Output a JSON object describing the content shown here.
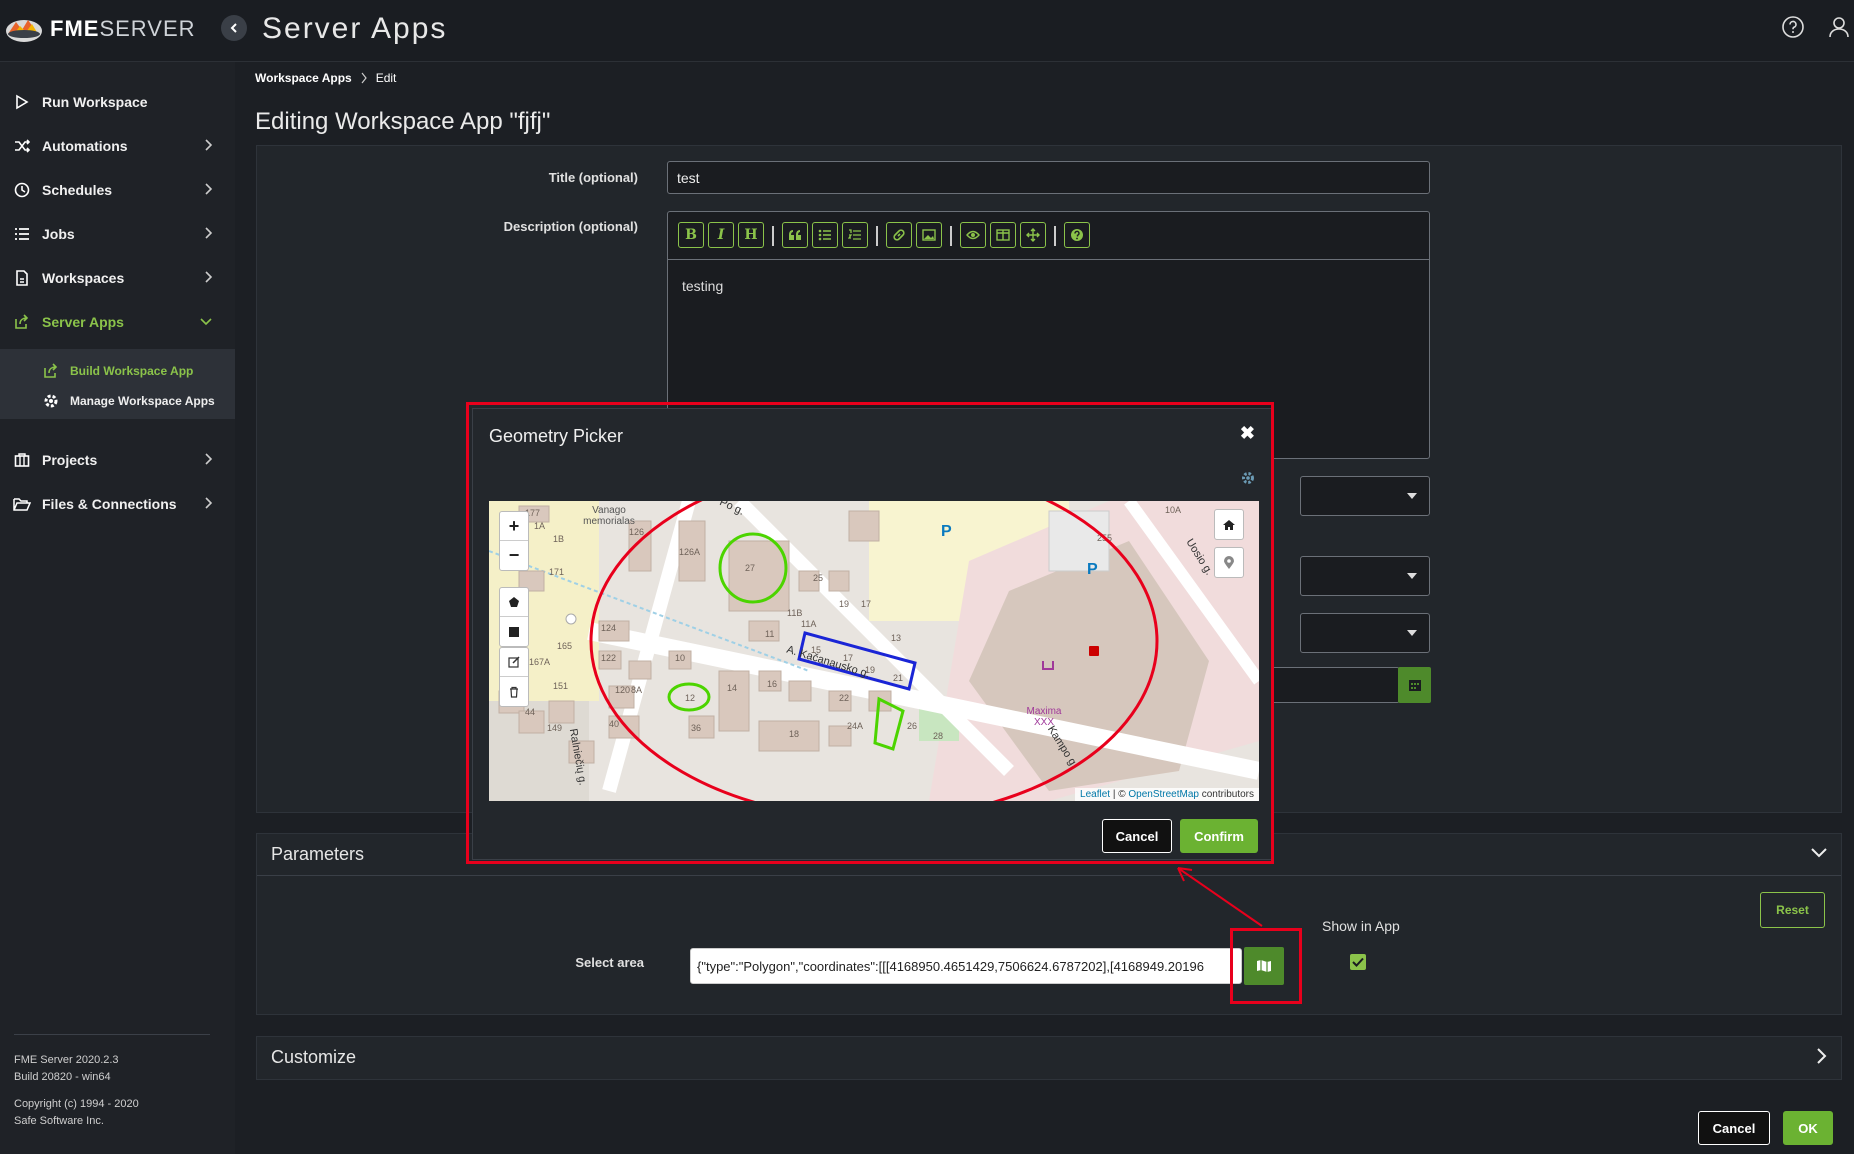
{
  "header": {
    "brand_bold": "FME",
    "brand_rest": "SERVER",
    "page_title": "Server Apps"
  },
  "sidebar": {
    "items": [
      {
        "label": "Run Workspace"
      },
      {
        "label": "Automations"
      },
      {
        "label": "Schedules"
      },
      {
        "label": "Jobs"
      },
      {
        "label": "Workspaces"
      },
      {
        "label": "Server Apps"
      },
      {
        "label": "Projects"
      },
      {
        "label": "Files & Connections"
      }
    ],
    "sub_items": [
      {
        "label": "Build Workspace App"
      },
      {
        "label": "Manage Workspace Apps"
      }
    ],
    "footer": {
      "version": "FME Server 2020.2.3",
      "build": "Build 20820 - win64",
      "copyright": "Copyright (c) 1994 - 2020",
      "company": "Safe Software Inc."
    }
  },
  "breadcrumb": {
    "parent": "Workspace Apps",
    "current": "Edit"
  },
  "page": {
    "title": "Editing Workspace App \"fjfj\""
  },
  "form": {
    "title_label": "Title (optional)",
    "title_value": "test",
    "description_label": "Description (optional)",
    "description_value": "testing"
  },
  "parameters": {
    "header": "Parameters",
    "reset_label": "Reset",
    "show_in_app_label": "Show in App",
    "select_area_label": "Select area",
    "select_area_value": "{\"type\":\"Polygon\",\"coordinates\":[[[4168950.4651429,7506624.6787202],[4168949.20196"
  },
  "customize": {
    "header": "Customize"
  },
  "footer_buttons": {
    "cancel": "Cancel",
    "ok": "OK"
  },
  "modal": {
    "title": "Geometry Picker",
    "cancel": "Cancel",
    "confirm": "Confirm",
    "map": {
      "street_1": "A. Kačanausko g.",
      "street_2": "Kampo g.",
      "street_3": "Uosio g.",
      "street_4": "Pо g.",
      "street_5": "Ralniečių g.",
      "poi_1": "Vanago memorialas",
      "poi_2": "Maxima XXX",
      "parking": "P",
      "house_numbers": [
        "177",
        "1A",
        "1B",
        "126",
        "126A",
        "27",
        "25",
        "17",
        "19",
        "11B",
        "11A",
        "171",
        "124",
        "122",
        "11",
        "15",
        "17",
        "19",
        "21",
        "13",
        "10",
        "14",
        "120",
        "8A",
        "12",
        "16",
        "22",
        "46",
        "44",
        "151",
        "40",
        "36",
        "18",
        "24A",
        "26",
        "28",
        "165",
        "167A",
        "149",
        "10A",
        "255"
      ],
      "attribution_leaflet": "Leaflet",
      "attribution_sep": " | © ",
      "attribution_osm": "OpenStreetMap",
      "attribution_contrib": " contributors"
    }
  }
}
